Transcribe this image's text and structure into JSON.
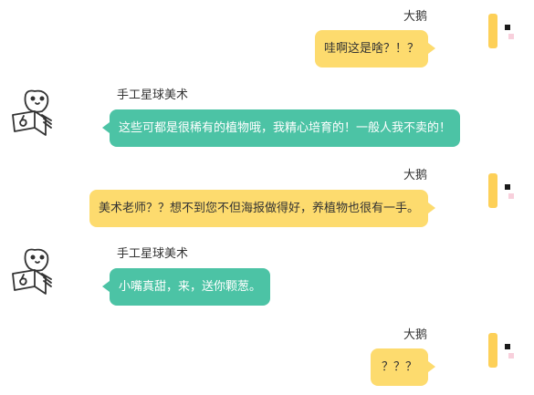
{
  "messages": [
    {
      "sender": "大鹅",
      "text": "哇啊这是啥？！？",
      "side": "right"
    },
    {
      "sender": "手工星球美术",
      "text": "这些可都是很稀有的植物哦，我精心培育的！一般人我不卖的！",
      "side": "left"
    },
    {
      "sender": "大鹅",
      "text": "美术老师？？想不到您不但海报做得好，养植物也很有一手。",
      "side": "right"
    },
    {
      "sender": "手工星球美术",
      "text": "小嘴真甜，来，送你颗葱。",
      "side": "left"
    },
    {
      "sender": "大鹅",
      "text": "？？？",
      "side": "right"
    }
  ],
  "colors": {
    "outgoing_bubble": "#fddb6e",
    "incoming_bubble": "#4cc3a5",
    "background": "#ffffff"
  },
  "icons": {
    "self_avatar": "yellow-goose-avatar-icon",
    "other_avatar": "doodle-cat-laptop-avatar-icon"
  }
}
